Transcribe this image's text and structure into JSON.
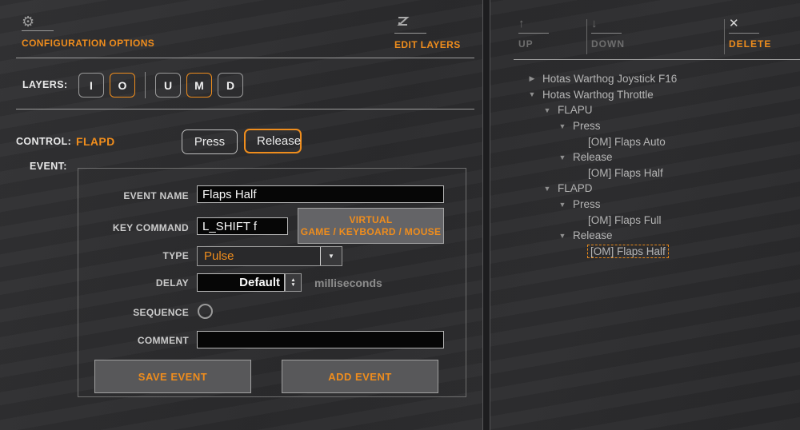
{
  "accent_color": "#ef8d1d",
  "icons": {
    "gear": "⚙",
    "up": "↑",
    "down": "↓",
    "delete": "✕",
    "dropdown": "▼",
    "spin_up": "▲",
    "spin_down": "▼",
    "collapsed": "▶",
    "expanded": "▼"
  },
  "left": {
    "config_options_label": "CONFIGURATION OPTIONS",
    "edit_layers_label": "EDIT LAYERS",
    "layers": {
      "label": "LAYERS:",
      "buttons": [
        {
          "label": "I",
          "active": false
        },
        {
          "label": "O",
          "active": true
        },
        {
          "label": "U",
          "active": false
        },
        {
          "label": "M",
          "active": true
        },
        {
          "label": "D",
          "active": false
        }
      ]
    },
    "control": {
      "label": "CONTROL:",
      "value": "FLAPD"
    },
    "press_label": "Press",
    "release_label": "Release",
    "event_label": "EVENT:",
    "form": {
      "event_name": {
        "label": "EVENT NAME",
        "value": "Flaps Half"
      },
      "key_command": {
        "label": "KEY COMMAND",
        "value": "L_SHIFT f"
      },
      "virtual_button": {
        "line1": "VIRTUAL",
        "line2": "GAME / KEYBOARD / MOUSE"
      },
      "type": {
        "label": "TYPE",
        "value": "Pulse"
      },
      "delay": {
        "label": "DELAY",
        "value": "Default",
        "unit": "milliseconds"
      },
      "sequence": {
        "label": "SEQUENCE",
        "checked": false
      },
      "comment": {
        "label": "COMMENT",
        "value": ""
      },
      "save_label": "SAVE EVENT",
      "add_label": "ADD EVENT"
    }
  },
  "right": {
    "toolbar": {
      "up": "UP",
      "down": "DOWN",
      "delete": "DELETE"
    },
    "tree": [
      {
        "depth": 0,
        "arrow": "collapsed",
        "label": "Hotas Warthog Joystick F16",
        "selected": false
      },
      {
        "depth": 0,
        "arrow": "expanded",
        "label": "Hotas Warthog Throttle",
        "selected": false
      },
      {
        "depth": 1,
        "arrow": "expanded",
        "label": "FLAPU",
        "selected": false
      },
      {
        "depth": 2,
        "arrow": "expanded",
        "label": "Press",
        "selected": false
      },
      {
        "depth": 3,
        "arrow": "none",
        "label": "[OM] Flaps Auto",
        "selected": false
      },
      {
        "depth": 2,
        "arrow": "expanded",
        "label": "Release",
        "selected": false
      },
      {
        "depth": 3,
        "arrow": "none",
        "label": "[OM] Flaps Half",
        "selected": false
      },
      {
        "depth": 1,
        "arrow": "expanded",
        "label": "FLAPD",
        "selected": false
      },
      {
        "depth": 2,
        "arrow": "expanded",
        "label": "Press",
        "selected": false
      },
      {
        "depth": 3,
        "arrow": "none",
        "label": "[OM] Flaps Full",
        "selected": false
      },
      {
        "depth": 2,
        "arrow": "expanded",
        "label": "Release",
        "selected": false
      },
      {
        "depth": 3,
        "arrow": "none",
        "label": "[OM] Flaps Half",
        "selected": true
      }
    ]
  }
}
